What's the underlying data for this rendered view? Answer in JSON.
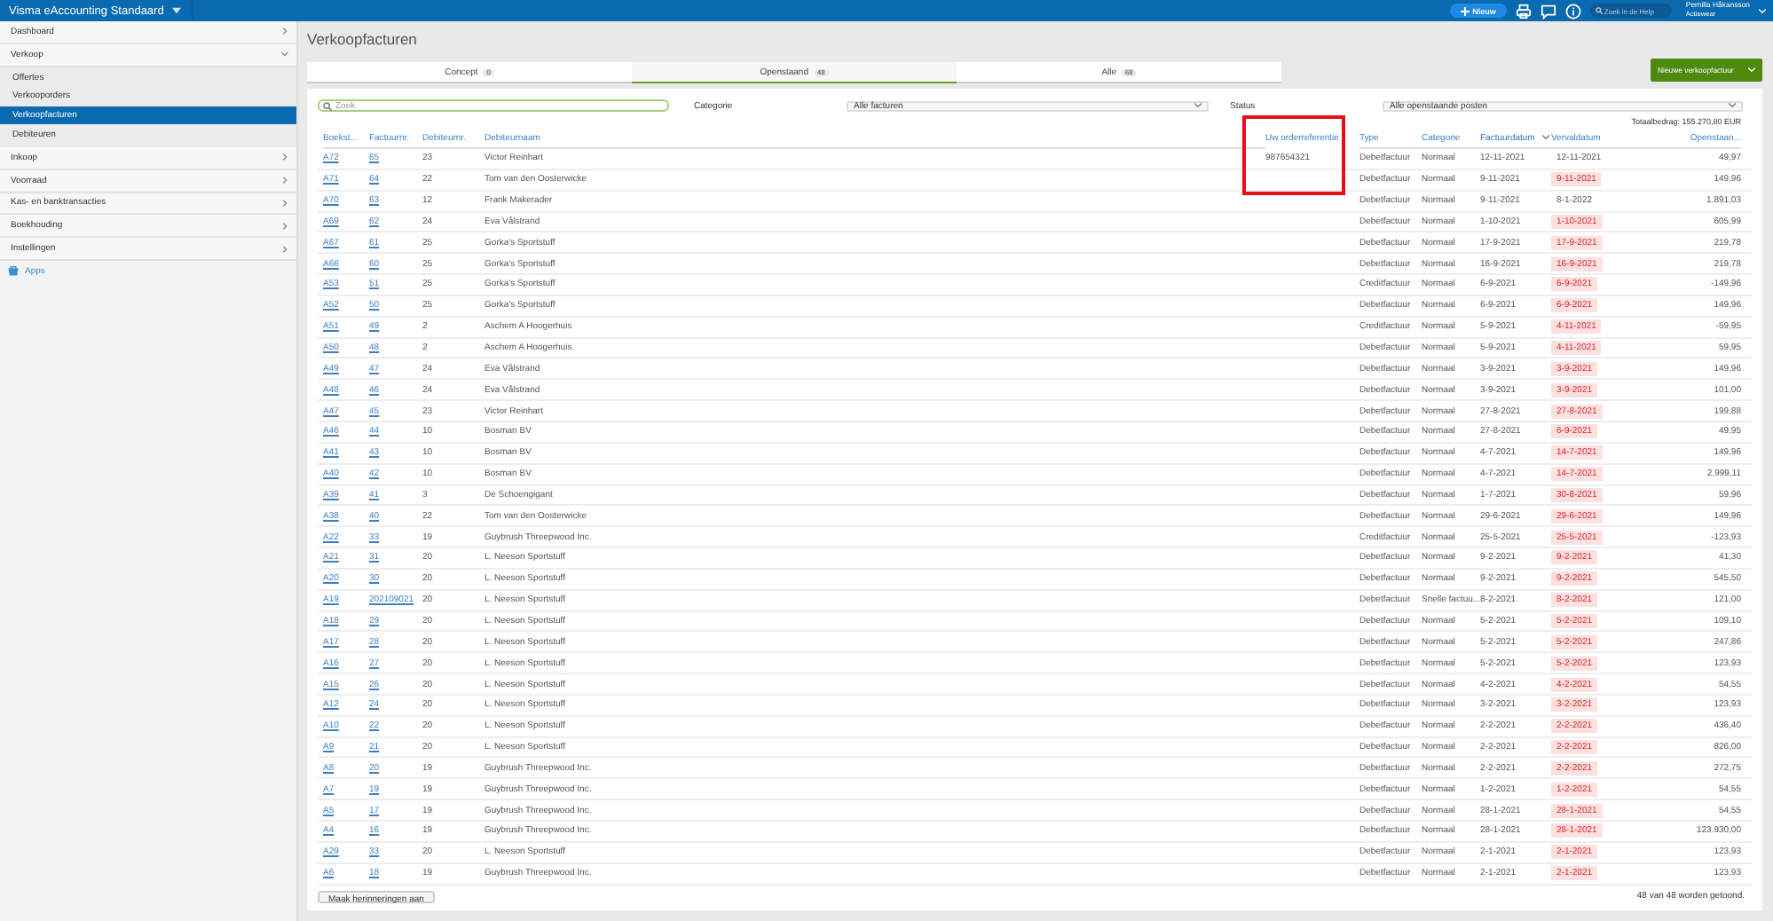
{
  "topbar": {
    "product": "Visma eAccounting Standaard",
    "new_button": "Nieuw",
    "help_search": {
      "placeholder": "Zoek in de Help"
    },
    "user": {
      "name": "Pernilla Håkansson",
      "company": "Actiewear"
    }
  },
  "sidebar": {
    "items": [
      {
        "label": "Dashboard",
        "expanded": false
      },
      {
        "label": "Verkoop",
        "expanded": true,
        "children": [
          {
            "label": "Offertes",
            "selected": false
          },
          {
            "label": "Verkooporders",
            "selected": false
          },
          {
            "label": "Verkoopfacturen",
            "selected": true
          },
          {
            "label": "Debiteuren",
            "selected": false
          }
        ]
      },
      {
        "label": "Inkoop",
        "expanded": false
      },
      {
        "label": "Voorraad",
        "expanded": false
      },
      {
        "label": "Kas- en banktransacties",
        "expanded": false
      },
      {
        "label": "Boekhouding",
        "expanded": false
      },
      {
        "label": "Instellingen",
        "expanded": false
      }
    ],
    "apps": "Apps"
  },
  "page_title": "Verkoopfacturen",
  "tabs": [
    {
      "label": "Concept",
      "count": "0",
      "selected": false
    },
    {
      "label": "Openstaand",
      "count": "48",
      "selected": true
    },
    {
      "label": "Alle",
      "count": "68",
      "selected": false
    }
  ],
  "new_invoice_button": "Nieuwe verkoopfactuur",
  "filters": {
    "search": {
      "placeholder": "Zoek"
    },
    "category_label": "Categorie",
    "category_value": "Alle facturen",
    "status_label": "Status",
    "status_value": "Alle openstaande posten"
  },
  "total": "Totaalbedrag: 155.270,80 EUR",
  "table": {
    "columns": [
      {
        "label": "Boekst...",
        "sorted": false,
        "highlighted": false
      },
      {
        "label": "Factuurnr.",
        "sorted": false,
        "highlighted": false
      },
      {
        "label": "Debiteurnr.",
        "sorted": false,
        "highlighted": false
      },
      {
        "label": "Debiteurnaam",
        "sorted": false,
        "highlighted": false
      },
      {
        "label": "Uw orderreferentie",
        "sorted": false,
        "highlighted": true
      },
      {
        "label": "Type",
        "sorted": false,
        "highlighted": false
      },
      {
        "label": "Categorie",
        "sorted": false,
        "highlighted": false
      },
      {
        "label": "Factuurdatum",
        "sorted": true,
        "highlighted": false
      },
      {
        "label": "Vervaldatum",
        "sorted": false,
        "highlighted": false
      },
      {
        "label": "Openstaan...",
        "sorted": false,
        "highlighted": false
      }
    ],
    "rows": [
      {
        "entry": "A72",
        "invoice": "65",
        "customer_no": "23",
        "customer": "Victor Reinhart",
        "reference": "987654321",
        "type": "Debetfactuur",
        "category": "Normaal",
        "invoice_date": "12-11-2021",
        "due_date": "12-11-2021",
        "overdue": false,
        "amount": "49,97"
      },
      {
        "entry": "A71",
        "invoice": "64",
        "customer_no": "22",
        "customer": "Tom van den Oosterwicke",
        "type": "Debetfactuur",
        "category": "Normaal",
        "invoice_date": "9-11-2021",
        "due_date": "9-11-2021",
        "overdue": true,
        "amount": "149,96"
      },
      {
        "entry": "A70",
        "invoice": "63",
        "customer_no": "12",
        "customer": "Frank Makerader",
        "type": "Debetfactuur",
        "category": "Normaal",
        "invoice_date": "9-11-2021",
        "due_date": "8-1-2022",
        "overdue": false,
        "amount": "1.891,03"
      },
      {
        "entry": "A69",
        "invoice": "62",
        "customer_no": "24",
        "customer": "Eva Vålstrand",
        "type": "Debetfactuur",
        "category": "Normaal",
        "invoice_date": "1-10-2021",
        "due_date": "1-10-2021",
        "overdue": true,
        "amount": "605,99"
      },
      {
        "entry": "A67",
        "invoice": "61",
        "customer_no": "25",
        "customer": "Gorka's Sportstuff",
        "type": "Debetfactuur",
        "category": "Normaal",
        "invoice_date": "17-9-2021",
        "due_date": "17-9-2021",
        "overdue": true,
        "amount": "219,78"
      },
      {
        "entry": "A66",
        "invoice": "60",
        "customer_no": "25",
        "customer": "Gorka's Sportstuff",
        "type": "Debetfactuur",
        "category": "Normaal",
        "invoice_date": "16-9-2021",
        "due_date": "16-9-2021",
        "overdue": true,
        "amount": "219,78"
      },
      {
        "entry": "A53",
        "invoice": "51",
        "customer_no": "25",
        "customer": "Gorka's Sportstuff",
        "type": "Creditfactuur",
        "category": "Normaal",
        "invoice_date": "6-9-2021",
        "due_date": "6-9-2021",
        "overdue": true,
        "amount": "-149,96"
      },
      {
        "entry": "A52",
        "invoice": "50",
        "customer_no": "25",
        "customer": "Gorka's Sportstuff",
        "type": "Debetfactuur",
        "category": "Normaal",
        "invoice_date": "6-9-2021",
        "due_date": "6-9-2021",
        "overdue": true,
        "amount": "149,96"
      },
      {
        "entry": "A51",
        "invoice": "49",
        "customer_no": "2",
        "customer": "Aschem A Hoogerhuis",
        "type": "Creditfactuur",
        "category": "Normaal",
        "invoice_date": "5-9-2021",
        "due_date": "4-11-2021",
        "overdue": true,
        "amount": "-59,95"
      },
      {
        "entry": "A50",
        "invoice": "48",
        "customer_no": "2",
        "customer": "Aschem A Hoogerhuis",
        "type": "Debetfactuur",
        "category": "Normaal",
        "invoice_date": "5-9-2021",
        "due_date": "4-11-2021",
        "overdue": true,
        "amount": "59,95"
      },
      {
        "entry": "A49",
        "invoice": "47",
        "customer_no": "24",
        "customer": "Eva Vålstrand",
        "type": "Debetfactuur",
        "category": "Normaal",
        "invoice_date": "3-9-2021",
        "due_date": "3-9-2021",
        "overdue": true,
        "amount": "149,96"
      },
      {
        "entry": "A48",
        "invoice": "46",
        "customer_no": "24",
        "customer": "Eva Vålstrand",
        "type": "Debetfactuur",
        "category": "Normaal",
        "invoice_date": "3-9-2021",
        "due_date": "3-9-2021",
        "overdue": true,
        "amount": "101,00"
      },
      {
        "entry": "A47",
        "invoice": "45",
        "customer_no": "23",
        "customer": "Victor Reinhart",
        "type": "Debetfactuur",
        "category": "Normaal",
        "invoice_date": "27-8-2021",
        "due_date": "27-8-2021",
        "overdue": true,
        "amount": "199,88"
      },
      {
        "entry": "A46",
        "invoice": "44",
        "customer_no": "10",
        "customer": "Bosman BV",
        "type": "Debetfactuur",
        "category": "Normaal",
        "invoice_date": "27-8-2021",
        "due_date": "6-9-2021",
        "overdue": true,
        "amount": "49,95"
      },
      {
        "entry": "A41",
        "invoice": "43",
        "customer_no": "10",
        "customer": "Bosman BV",
        "type": "Debetfactuur",
        "category": "Normaal",
        "invoice_date": "4-7-2021",
        "due_date": "14-7-2021",
        "overdue": true,
        "amount": "149,96"
      },
      {
        "entry": "A40",
        "invoice": "42",
        "customer_no": "10",
        "customer": "Bosman BV",
        "type": "Debetfactuur",
        "category": "Normaal",
        "invoice_date": "4-7-2021",
        "due_date": "14-7-2021",
        "overdue": true,
        "amount": "2.999,11"
      },
      {
        "entry": "A39",
        "invoice": "41",
        "customer_no": "3",
        "customer": "De Schoengigant",
        "type": "Debetfactuur",
        "category": "Normaal",
        "invoice_date": "1-7-2021",
        "due_date": "30-8-2021",
        "overdue": true,
        "amount": "59,96"
      },
      {
        "entry": "A38",
        "invoice": "40",
        "customer_no": "22",
        "customer": "Tom van den Oosterwicke",
        "type": "Debetfactuur",
        "category": "Normaal",
        "invoice_date": "29-6-2021",
        "due_date": "29-6-2021",
        "overdue": true,
        "amount": "149,96"
      },
      {
        "entry": "A22",
        "invoice": "33",
        "customer_no": "19",
        "customer": "Guybrush Threepwood Inc.",
        "type": "Creditfactuur",
        "category": "Normaal",
        "invoice_date": "25-5-2021",
        "due_date": "25-5-2021",
        "overdue": true,
        "amount": "-123,93"
      },
      {
        "entry": "A21",
        "invoice": "31",
        "customer_no": "20",
        "customer": "L. Neeson Sportstuff",
        "type": "Debetfactuur",
        "category": "Normaal",
        "invoice_date": "9-2-2021",
        "due_date": "9-2-2021",
        "overdue": true,
        "amount": "41,30"
      },
      {
        "entry": "A20",
        "invoice": "30",
        "customer_no": "20",
        "customer": "L. Neeson Sportstuff",
        "type": "Debetfactuur",
        "category": "Normaal",
        "invoice_date": "9-2-2021",
        "due_date": "9-2-2021",
        "overdue": true,
        "amount": "545,50"
      },
      {
        "entry": "A19",
        "invoice": "202109021",
        "customer_no": "20",
        "customer": "L. Neeson Sportstuff",
        "type": "Debetfactuur",
        "category": "Snelle factuu...",
        "invoice_date": "8-2-2021",
        "due_date": "8-2-2021",
        "overdue": true,
        "amount": "121,00"
      },
      {
        "entry": "A18",
        "invoice": "29",
        "customer_no": "20",
        "customer": "L. Neeson Sportstuff",
        "type": "Debetfactuur",
        "category": "Normaal",
        "invoice_date": "5-2-2021",
        "due_date": "5-2-2021",
        "overdue": true,
        "amount": "109,10"
      },
      {
        "entry": "A17",
        "invoice": "28",
        "customer_no": "20",
        "customer": "L. Neeson Sportstuff",
        "type": "Debetfactuur",
        "category": "Normaal",
        "invoice_date": "5-2-2021",
        "due_date": "5-2-2021",
        "overdue": true,
        "amount": "247,86"
      },
      {
        "entry": "A16",
        "invoice": "27",
        "customer_no": "20",
        "customer": "L. Neeson Sportstuff",
        "type": "Debetfactuur",
        "category": "Normaal",
        "invoice_date": "5-2-2021",
        "due_date": "5-2-2021",
        "overdue": true,
        "amount": "123,93"
      },
      {
        "entry": "A15",
        "invoice": "26",
        "customer_no": "20",
        "customer": "L. Neeson Sportstuff",
        "type": "Debetfactuur",
        "category": "Normaal",
        "invoice_date": "4-2-2021",
        "due_date": "4-2-2021",
        "overdue": true,
        "amount": "54,55"
      },
      {
        "entry": "A12",
        "invoice": "24",
        "customer_no": "20",
        "customer": "L. Neeson Sportstuff",
        "type": "Debetfactuur",
        "category": "Normaal",
        "invoice_date": "3-2-2021",
        "due_date": "3-2-2021",
        "overdue": true,
        "amount": "123,93"
      },
      {
        "entry": "A10",
        "invoice": "22",
        "customer_no": "20",
        "customer": "L. Neeson Sportstuff",
        "type": "Debetfactuur",
        "category": "Normaal",
        "invoice_date": "2-2-2021",
        "due_date": "2-2-2021",
        "overdue": true,
        "amount": "436,40"
      },
      {
        "entry": "A9",
        "invoice": "21",
        "customer_no": "20",
        "customer": "L. Neeson Sportstuff",
        "type": "Debetfactuur",
        "category": "Normaal",
        "invoice_date": "2-2-2021",
        "due_date": "2-2-2021",
        "overdue": true,
        "amount": "826,00"
      },
      {
        "entry": "A8",
        "invoice": "20",
        "customer_no": "19",
        "customer": "Guybrush Threepwood Inc.",
        "type": "Debetfactuur",
        "category": "Normaal",
        "invoice_date": "2-2-2021",
        "due_date": "2-2-2021",
        "overdue": true,
        "amount": "272,75"
      },
      {
        "entry": "A7",
        "invoice": "19",
        "customer_no": "19",
        "customer": "Guybrush Threepwood Inc.",
        "type": "Debetfactuur",
        "category": "Normaal",
        "invoice_date": "1-2-2021",
        "due_date": "1-2-2021",
        "overdue": true,
        "amount": "54,55"
      },
      {
        "entry": "A5",
        "invoice": "17",
        "customer_no": "19",
        "customer": "Guybrush Threepwood Inc.",
        "type": "Debetfactuur",
        "category": "Normaal",
        "invoice_date": "28-1-2021",
        "due_date": "28-1-2021",
        "overdue": true,
        "amount": "54,55"
      },
      {
        "entry": "A4",
        "invoice": "16",
        "customer_no": "19",
        "customer": "Guybrush Threepwood Inc.",
        "type": "Debetfactuur",
        "category": "Normaal",
        "invoice_date": "28-1-2021",
        "due_date": "28-1-2021",
        "overdue": true,
        "amount": "123.930,00"
      },
      {
        "entry": "A29",
        "invoice": "33",
        "customer_no": "20",
        "customer": "L. Neeson Sportstuff",
        "type": "Debetfactuur",
        "category": "Normaal",
        "invoice_date": "2-1-2021",
        "due_date": "2-1-2021",
        "overdue": true,
        "amount": "123,93"
      },
      {
        "entry": "A6",
        "invoice": "18",
        "customer_no": "19",
        "customer": "Guybrush Threepwood Inc.",
        "type": "Debetfactuur",
        "category": "Normaal",
        "invoice_date": "2-1-2021",
        "due_date": "2-1-2021",
        "overdue": true,
        "amount": "123,93"
      }
    ]
  },
  "reminders_button": "Maak herinneringen aan",
  "footer_count": "48 van 48 worden getoond."
}
